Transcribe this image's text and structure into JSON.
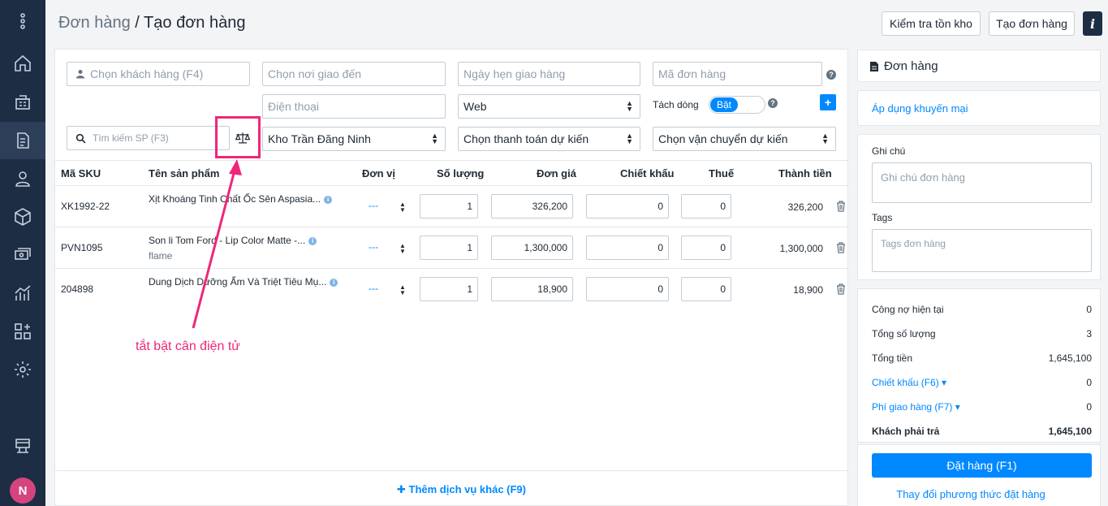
{
  "breadcrumb": {
    "parent": "Đơn hàng",
    "separator": " / ",
    "current": "Tạo đơn hàng"
  },
  "header": {
    "check_stock_label": "Kiểm tra tồn kho",
    "create_order_label": "Tạo đơn hàng",
    "info_label": "i"
  },
  "form": {
    "customer_placeholder": "Chọn khách hàng (F4)",
    "destination_placeholder": "Chọn nơi giao đến",
    "delivery_date_placeholder": "Ngày hẹn giao hàng",
    "order_code_placeholder": "Mã đơn hàng",
    "phone_placeholder": "Điện thoại",
    "source_value": "Web",
    "split_line_label": "Tách dòng",
    "split_toggle_label": "Bật",
    "search_placeholder": "Tìm kiếm SP (F3)",
    "warehouse_value": "Kho Trần Đăng Ninh",
    "payment_value": "Chọn thanh toán dự kiến",
    "shipping_value": "Chọn vận chuyển dự kiến"
  },
  "table": {
    "headers": [
      "Mã SKU",
      "Tên sản phẩm",
      "Đơn vị",
      "Số lượng",
      "Đơn giá",
      "Chiết khấu",
      "Thuế",
      "Thành tiền"
    ],
    "rows": [
      {
        "sku": "XK1992-22",
        "name": "Xịt Khoáng Tinh Chất Ốc Sên Aspasia...",
        "variant": "",
        "unit": "---",
        "qty": "1",
        "price": "326,200",
        "discount": "0",
        "tax": "0",
        "total": "326,200"
      },
      {
        "sku": "PVN1095",
        "name": "Son li Tom Ford - Lip Color Matte -...",
        "variant": "flame",
        "unit": "---",
        "qty": "1",
        "price": "1,300,000",
        "discount": "0",
        "tax": "0",
        "total": "1,300,000"
      },
      {
        "sku": "204898",
        "name": "Dung Dịch Dưỡng Ẩm Và Triệt Tiêu Mụ...",
        "variant": "",
        "unit": "---",
        "qty": "1",
        "price": "18,900",
        "discount": "0",
        "tax": "0",
        "total": "18,900"
      }
    ],
    "add_service_label": "Thêm dịch vụ khác (F9)"
  },
  "annotation": {
    "text": "tắt bật cân điện tử",
    "color": "#f0267a"
  },
  "side": {
    "order_title": "Đơn hàng",
    "promo_label": "Áp dụng khuyến mại",
    "note_label": "Ghi chú",
    "note_placeholder": "Ghi chú đơn hàng",
    "tags_label": "Tags",
    "tags_placeholder": "Tags đơn hàng",
    "summary": {
      "debt_label": "Công nợ hiện tại",
      "debt_value": "0",
      "qty_label": "Tổng số lượng",
      "qty_value": "3",
      "total_label": "Tổng tiền",
      "total_value": "1,645,100",
      "discount_label": "Chiết khấu (F6)",
      "discount_value": "0",
      "shipping_label": "Phí giao hàng (F7)",
      "shipping_value": "0",
      "payable_label": "Khách phải trả",
      "payable_value": "1,645,100"
    },
    "place_order_label": "Đặt hàng (F1)",
    "change_method_label": "Thay đổi phương thức đặt hàng"
  },
  "user": {
    "avatar_initial": "N"
  },
  "colors": {
    "sidebar": "#1d2d44",
    "accent": "#0088ff",
    "annotation": "#f0267a"
  }
}
